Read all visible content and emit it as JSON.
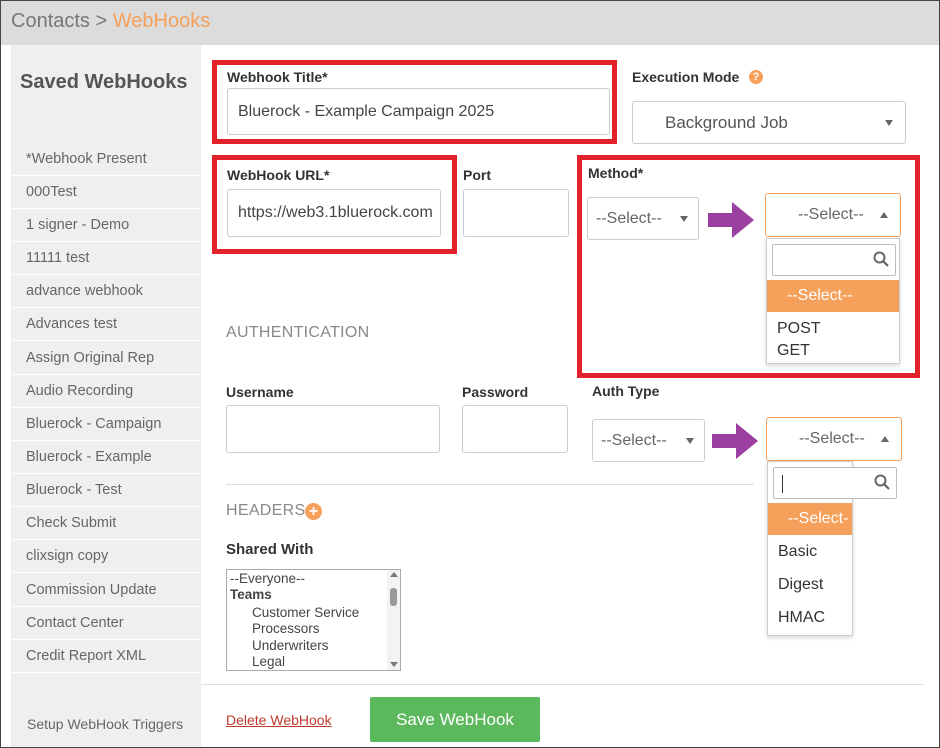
{
  "breadcrumb": {
    "parent": "Contacts",
    "separator": ">",
    "current": "WebHooks"
  },
  "sidebar": {
    "title": "Saved WebHooks",
    "items": [
      "*Webhook Present",
      "000Test",
      "1 signer - Demo",
      "11111 test",
      "advance webhook",
      "Advances test",
      "Assign Original Rep",
      "Audio Recording",
      "Bluerock - Campaign",
      "Bluerock - Example",
      "Bluerock - Test",
      "Check Submit",
      "clixsign copy",
      "Commission Update",
      "Contact Center",
      "Credit Report XML"
    ],
    "footer_link": "Setup WebHook Triggers"
  },
  "form": {
    "title_label": "Webhook Title*",
    "title_value": "Bluerock - Example Campaign 2025",
    "exec_label": "Execution Mode",
    "exec_value": "Background Job",
    "url_label": "WebHook URL*",
    "url_value": "https://web3.1bluerock.com",
    "port_label": "Port",
    "method_label": "Method*",
    "select_placeholder": "--Select--",
    "method_options": [
      "--Select--",
      "POST",
      "GET"
    ],
    "auth_section": "AUTHENTICATION",
    "username_label": "Username",
    "password_label": "Password",
    "auth_type_label": "Auth Type",
    "auth_options": [
      "--Select--",
      "Basic",
      "Digest",
      "HMAC"
    ],
    "headers_section": "HEADERS",
    "shared_label": "Shared With",
    "shared_list": {
      "everyone": "--Everyone--",
      "group": "Teams",
      "members": [
        "Customer Service",
        "Processors",
        "Underwriters",
        "Legal"
      ]
    },
    "delete_label": "Delete WebHook",
    "save_label": "Save WebHook"
  },
  "colors": {
    "accent": "#f5a05b",
    "highlight": "#e3212b",
    "arrow": "#9b3fa1",
    "save": "#5cb85c"
  }
}
